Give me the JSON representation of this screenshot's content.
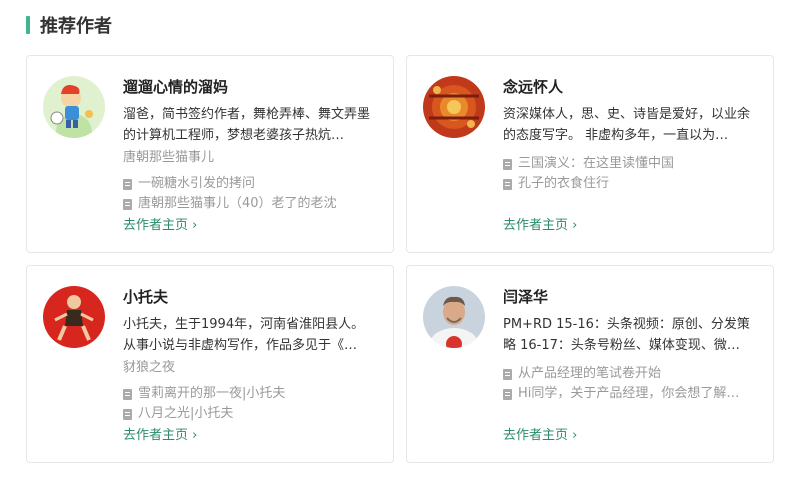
{
  "section": {
    "title": "推荐作者"
  },
  "authors": [
    {
      "name": "遛遛心情的溜妈",
      "bio": "溜爸，简书签约作者，舞枪弄棒、舞文弄墨的计算机工程师，梦想老婆孩子热炕…",
      "collection": "唐朝那些猫事儿",
      "articles": [
        "一碗糖水引发的拷问",
        "唐朝那些猫事儿（40）老了的老沈"
      ],
      "link": "去作者主页 ›"
    },
    {
      "name": "念远怀人",
      "bio": "资深媒体人，思、史、诗皆是爱好，以业余的态度写字。 非虚构多年，一直以为…",
      "collection": "",
      "articles": [
        "三国演义：在这里读懂中国",
        "孔子的衣食住行"
      ],
      "link": "去作者主页 ›"
    },
    {
      "name": "小托夫",
      "bio": "小托夫，生于1994年，河南省淮阳县人。从事小说与非虚构写作，作品多见于《…",
      "collection": "豺狼之夜",
      "articles": [
        "雪莉离开的那一夜|小托夫",
        "八月之光|小托夫"
      ],
      "link": "去作者主页 ›"
    },
    {
      "name": "闫泽华",
      "bio": "PM+RD 15-16：头条视频：原创、分发策略 16-17：头条号粉丝、媒体变现、微…",
      "collection": "",
      "articles": [
        "从产品经理的笔试卷开始",
        "Hi同学，关于产品经理，你会想了解…"
      ],
      "link": "去作者主页 ›"
    }
  ],
  "colors": {
    "accent": "#3fb68b",
    "link": "#2a8c6a",
    "muted": "#999999"
  }
}
